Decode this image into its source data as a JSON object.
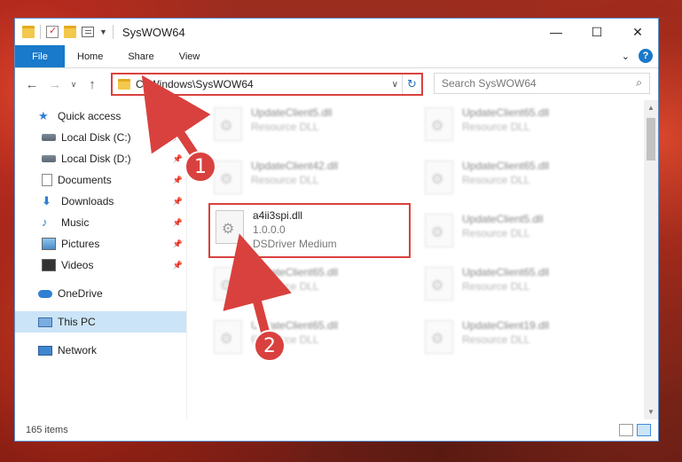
{
  "window": {
    "title": "SysWOW64",
    "controls": {
      "minimize": "—",
      "maximize": "☐",
      "close": "✕"
    }
  },
  "ribbon": {
    "tabs": [
      "File",
      "Home",
      "Share",
      "View"
    ],
    "expand": "⌄",
    "help": "?"
  },
  "nav": {
    "back": "←",
    "forward": "→",
    "recent": "∨",
    "up": "↑"
  },
  "address": {
    "path": "C:\\Windows\\SysWOW64",
    "dropdown": "∨",
    "refresh": "↻"
  },
  "search": {
    "placeholder": "Search SysWOW64",
    "icon": "magnifier-icon"
  },
  "sidebar": {
    "items": [
      {
        "label": "Quick access",
        "icon": "star-icon"
      },
      {
        "label": "Local Disk (C:)",
        "icon": "disk-icon",
        "pinned": true
      },
      {
        "label": "Local Disk (D:)",
        "icon": "disk-icon",
        "pinned": true
      },
      {
        "label": "Documents",
        "icon": "documents-icon",
        "pinned": true
      },
      {
        "label": "Downloads",
        "icon": "downloads-icon",
        "pinned": true
      },
      {
        "label": "Music",
        "icon": "music-icon",
        "pinned": true
      },
      {
        "label": "Pictures",
        "icon": "pictures-icon",
        "pinned": true
      },
      {
        "label": "Videos",
        "icon": "videos-icon",
        "pinned": true
      },
      {
        "label": "OneDrive",
        "icon": "onedrive-icon"
      },
      {
        "label": "This PC",
        "icon": "pc-icon",
        "selected": true
      },
      {
        "label": "Network",
        "icon": "network-icon"
      }
    ],
    "pin_glyph": "📌"
  },
  "files": [
    {
      "name": "UpdateClient5.dll",
      "sub": "Resource DLL"
    },
    {
      "name": "UpdateClient65.dll",
      "sub": "Resource DLL"
    },
    {
      "name": "UpdateClient42.dll",
      "sub": "Resource DLL"
    },
    {
      "name": "UpdateClient65.dll",
      "sub": "Resource DLL"
    },
    {
      "name": "a4ii3spi.dll",
      "sub": "1.0.0.0",
      "sub2": "DSDriver Medium"
    },
    {
      "name": "UpdateClient5.dll",
      "sub": "Resource DLL"
    },
    {
      "name": "UpdateClient65.dll",
      "sub": "Resource DLL"
    },
    {
      "name": "UpdateClient65.dll",
      "sub": "Resource DLL"
    },
    {
      "name": "UpdateClient65.dll",
      "sub": "Resource DLL"
    },
    {
      "name": "UpdateClient19.dll",
      "sub": "Resource DLL"
    }
  ],
  "status": {
    "count": "165 items"
  },
  "callouts": [
    "1",
    "2"
  ],
  "colors": {
    "accent": "#1979ca",
    "highlight": "#d9413e",
    "selected_bg": "#cce4f7"
  }
}
